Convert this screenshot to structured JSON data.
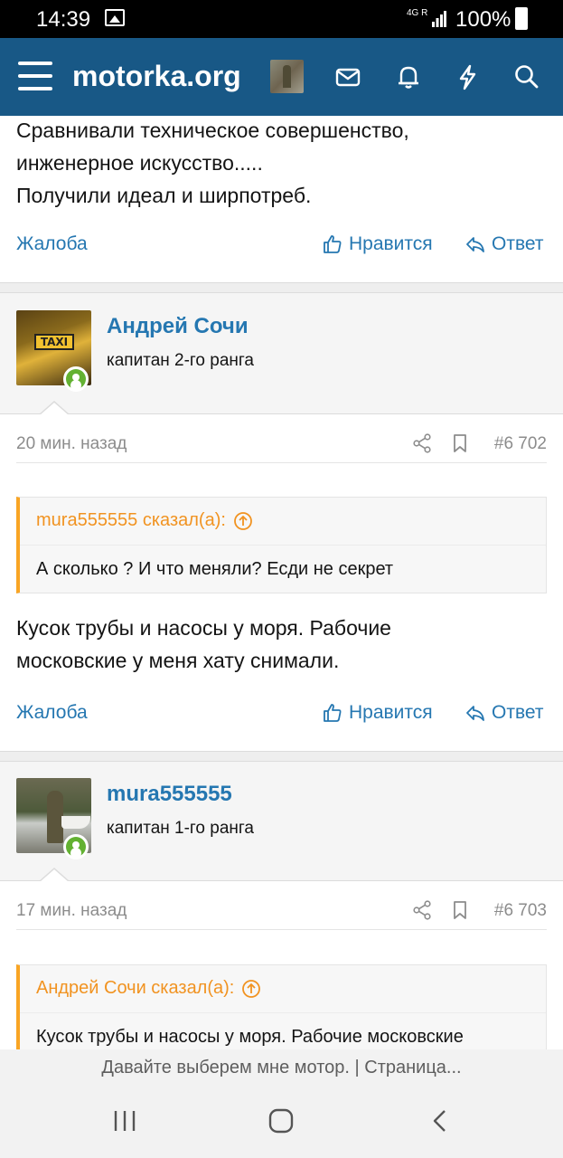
{
  "status_bar": {
    "time": "14:39",
    "network": "4G",
    "roaming": "R",
    "battery": "100%"
  },
  "header": {
    "site_name": "motorka.org"
  },
  "post_prev": {
    "lines": [
      "Сравнивали техническое совершенство,",
      "инженерное искусство.....",
      "Получили идеал и ширпотреб."
    ],
    "report": "Жалоба",
    "like": "Нравится",
    "reply": "Ответ"
  },
  "post_6702": {
    "username": "Андрей Сочи",
    "user_title": "капитан 2-го ранга",
    "time": "20 мин. назад",
    "number": "#6 702",
    "quote_author": "mura555555 сказал(а):",
    "quote_text": "А сколько ? И что меняли? Есди не секрет",
    "lines": [
      "Кусок трубы и насосы у моря. Рабочие",
      "московские у меня хату снимали."
    ],
    "report": "Жалоба",
    "like": "Нравится",
    "reply": "Ответ"
  },
  "post_6703": {
    "username": "mura555555",
    "user_title": "капитан 1-го ранга",
    "time": "17 мин. назад",
    "number": "#6 703",
    "quote_author": "Андрей Сочи сказал(а):",
    "quote_text": "Кусок трубы и насосы у моря. Рабочие московские"
  },
  "browser": {
    "page_title": "Давайте выберем мне мотор. | Страница..."
  },
  "icons": {
    "menu": "hamburger-icon",
    "mail": "envelope-icon",
    "alerts": "bell-icon",
    "whats_new": "lightning-icon",
    "search": "search-icon",
    "like": "thumbs-up-icon",
    "reply": "reply-arrow-icon",
    "share": "share-icon",
    "bookmark": "bookmark-icon",
    "quote_up": "arrow-up-circle-icon"
  },
  "colors": {
    "header_bg": "#185886",
    "link": "#2577b1",
    "quote_accent": "#f9a524",
    "online": "#63b132"
  }
}
